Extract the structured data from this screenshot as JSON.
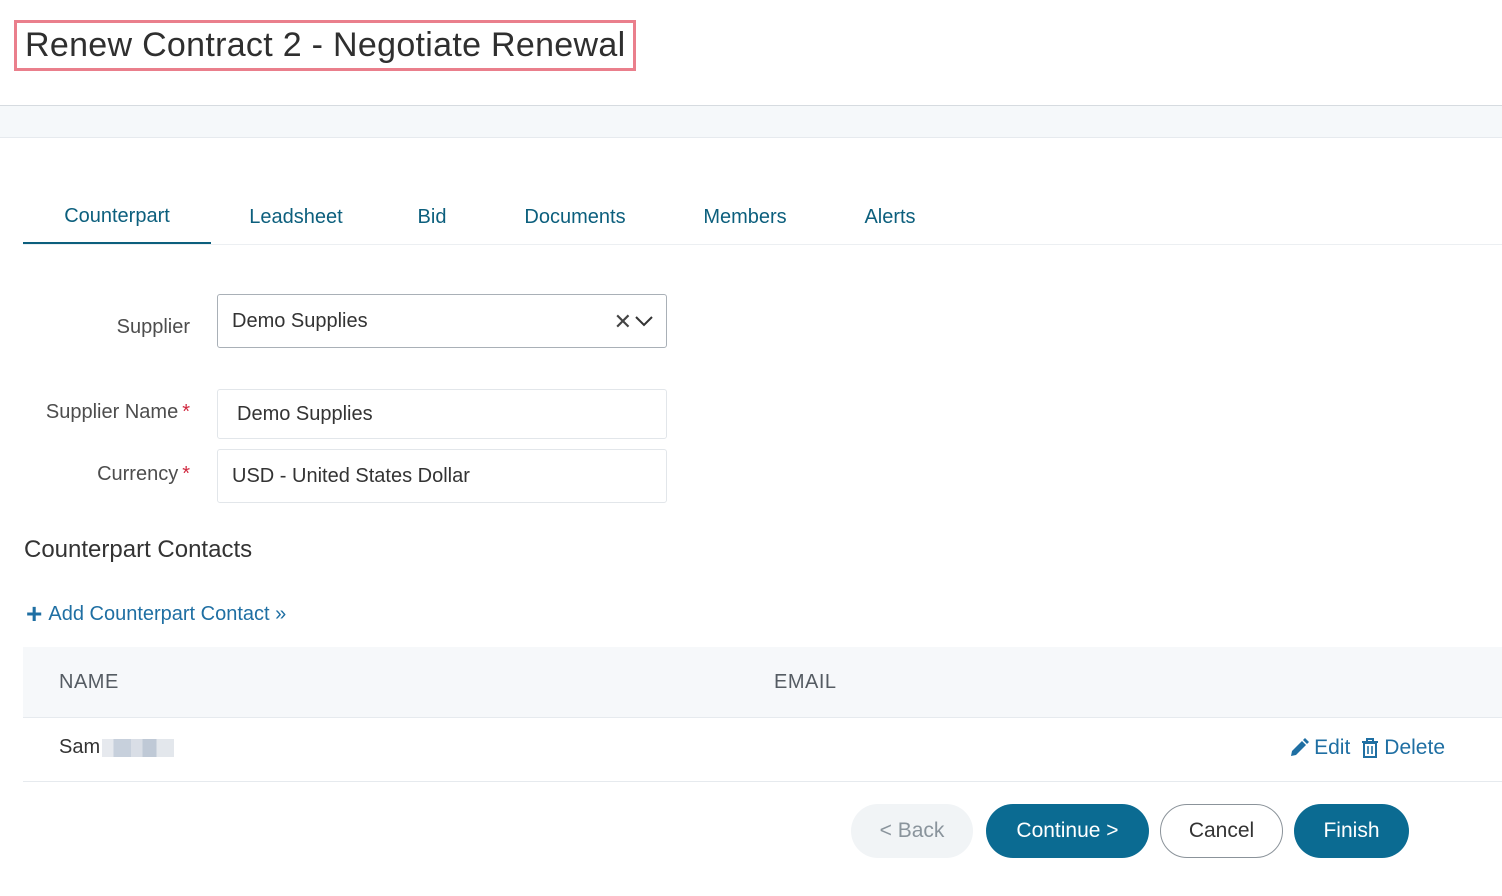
{
  "page": {
    "title": "Renew Contract 2 - Negotiate Renewal"
  },
  "tabs": [
    {
      "label": "Counterpart",
      "active": true
    },
    {
      "label": "Leadsheet"
    },
    {
      "label": "Bid"
    },
    {
      "label": "Documents"
    },
    {
      "label": "Members"
    },
    {
      "label": "Alerts"
    }
  ],
  "form": {
    "supplier": {
      "label": "Supplier",
      "value": "Demo Supplies"
    },
    "supplier_name": {
      "label": "Supplier Name",
      "required_mark": "*",
      "value": "Demo Supplies"
    },
    "currency": {
      "label": "Currency",
      "required_mark": "*",
      "value": "USD - United States Dollar"
    }
  },
  "contacts": {
    "section_title": "Counterpart Contacts",
    "add_link": "Add Counterpart Contact »",
    "columns": [
      "NAME",
      "EMAIL"
    ],
    "rows": [
      {
        "name": "Sam",
        "email": "",
        "edit_label": "Edit",
        "delete_label": "Delete"
      }
    ]
  },
  "buttons": {
    "back": "< Back",
    "continue": "Continue >",
    "cancel": "Cancel",
    "finish": "Finish"
  },
  "colors": {
    "accent": "#0b6b92",
    "link": "#1f6fa3",
    "title_highlight": "#ea7f8c",
    "required": "#d0273e"
  },
  "icons": {
    "add": "plus-icon",
    "edit": "pencil-icon",
    "delete": "trash-icon",
    "clear": "clear-x-icon",
    "dropdown": "chevron-down-icon"
  }
}
